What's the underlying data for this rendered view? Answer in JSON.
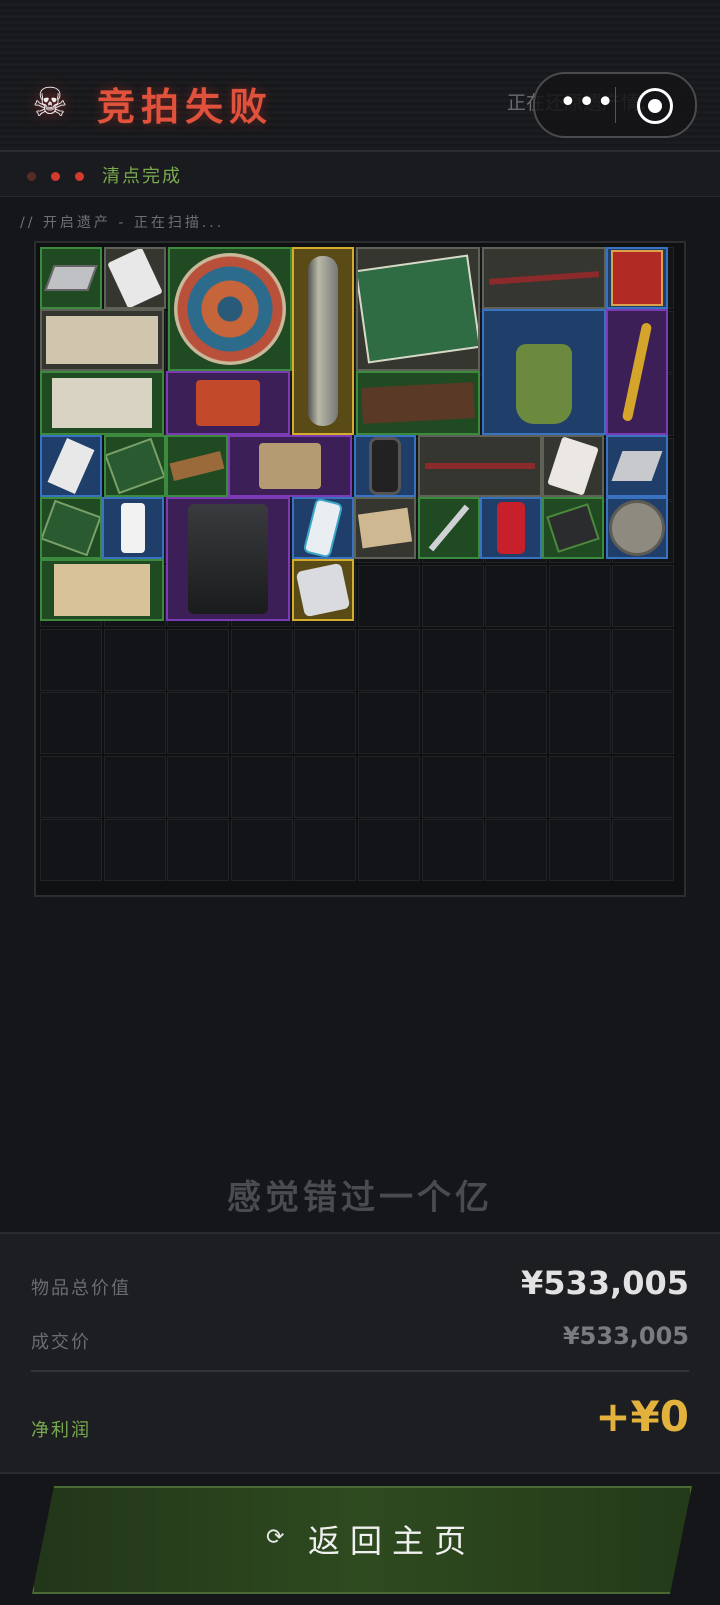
{
  "header": {
    "title": "竞拍失败",
    "status_text": "正在还原遗产情...",
    "skull_icon": "skull-icon",
    "more_icon": "more-icon",
    "target_icon": "target-icon"
  },
  "progress": {
    "label": "清点完成",
    "dots": [
      "#5a2a28",
      "#d23a2f",
      "#d23a2f"
    ]
  },
  "scan_text": "// 开启遗产 - 正在扫描...",
  "grid": {
    "rarity_colors": {
      "green": "#3b8a3e",
      "purple": "#7a3bb5",
      "blue": "#3a72c2",
      "gold": "#d4ad2d",
      "gray": "#5f6256"
    },
    "items": [
      {
        "name": "hard drive",
        "rarity": "green"
      },
      {
        "name": "playing card",
        "rarity": "gray"
      },
      {
        "name": "decorative plate",
        "rarity": "green"
      },
      {
        "name": "blueprint tube",
        "rarity": "gold"
      },
      {
        "name": "emergency candles box",
        "rarity": "gray"
      },
      {
        "name": "hammer",
        "rarity": "gray"
      },
      {
        "name": "red tin",
        "rarity": "blue"
      },
      {
        "name": "newspaper",
        "rarity": "gray"
      },
      {
        "name": "camping stove",
        "rarity": "blue"
      },
      {
        "name": "gold key",
        "rarity": "purple"
      },
      {
        "name": "old map",
        "rarity": "green"
      },
      {
        "name": "tactical pouch",
        "rarity": "purple"
      },
      {
        "name": "wood plank",
        "rarity": "green"
      },
      {
        "name": "cigarette pack",
        "rarity": "blue"
      },
      {
        "name": "circuit board",
        "rarity": "green"
      },
      {
        "name": "energy bar",
        "rarity": "green"
      },
      {
        "name": "radio",
        "rarity": "purple"
      },
      {
        "name": "smart watch",
        "rarity": "blue"
      },
      {
        "name": "hammer",
        "rarity": "gray"
      },
      {
        "name": "playing card",
        "rarity": "gray"
      },
      {
        "name": "silver plate",
        "rarity": "blue"
      },
      {
        "name": "circuit board",
        "rarity": "green"
      },
      {
        "name": "medicine bottle",
        "rarity": "blue"
      },
      {
        "name": "coffee machine",
        "rarity": "purple"
      },
      {
        "name": "thermometer gun",
        "rarity": "blue"
      },
      {
        "name": "small box",
        "rarity": "gray"
      },
      {
        "name": "tweezers",
        "rarity": "green"
      },
      {
        "name": "soda can",
        "rarity": "blue"
      },
      {
        "name": "battery pack",
        "rarity": "green"
      },
      {
        "name": "old coin",
        "rarity": "blue"
      },
      {
        "name": "parchment",
        "rarity": "green"
      },
      {
        "name": "scale device",
        "rarity": "gold"
      }
    ]
  },
  "slogan": "感觉错过一个亿",
  "summary": {
    "total_label": "物品总价值",
    "total_value": "¥533,005",
    "deal_label": "成交价",
    "deal_value": "¥533,005",
    "profit_label": "净利润",
    "profit_value": "+¥0",
    "colors": {
      "total": "#e2e2e2",
      "deal": "#7a7b80",
      "profit": "#e3b23c",
      "profit_label": "#79a94e"
    }
  },
  "return_button": {
    "label": "返回主页",
    "icon": "refresh-icon"
  }
}
